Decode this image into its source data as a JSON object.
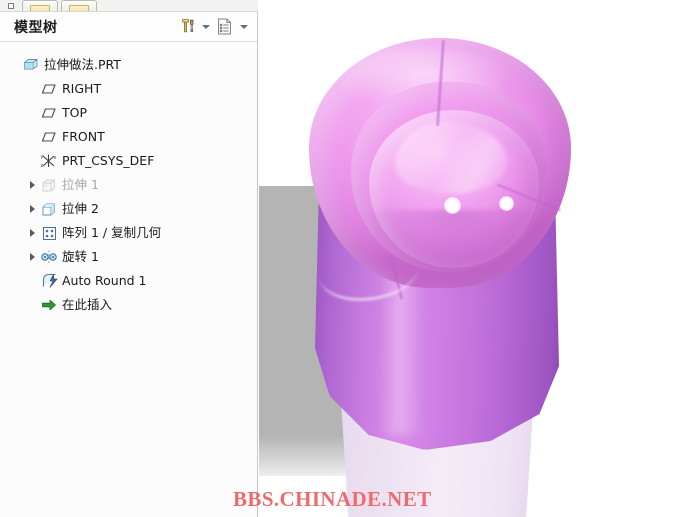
{
  "window": {
    "tabstrip": {
      "pin_icon": "pin-icon",
      "tabs": [
        {
          "name": "folder-tab-1",
          "icon": "folder-icon"
        },
        {
          "name": "folder-tab-2",
          "icon": "folder-icon"
        }
      ]
    }
  },
  "tree_panel": {
    "title": "模型树",
    "toolbar": [
      {
        "name": "settings-tools-button",
        "icon": "hammer-screwdriver-icon"
      },
      {
        "name": "settings-tools-dropdown",
        "icon": "chevron-down-icon"
      },
      {
        "name": "display-list-button",
        "icon": "document-list-icon"
      },
      {
        "name": "display-list-dropdown",
        "icon": "chevron-down-icon"
      }
    ],
    "items": [
      {
        "label": "拉伸做法.PRT",
        "icon": "part-icon",
        "level": 0,
        "expander": false,
        "dim": false
      },
      {
        "label": "RIGHT",
        "icon": "datum-plane-icon",
        "level": 1,
        "expander": false,
        "dim": false
      },
      {
        "label": "TOP",
        "icon": "datum-plane-icon",
        "level": 1,
        "expander": false,
        "dim": false
      },
      {
        "label": "FRONT",
        "icon": "datum-plane-icon",
        "level": 1,
        "expander": false,
        "dim": false
      },
      {
        "label": "PRT_CSYS_DEF",
        "icon": "coordinate-system-icon",
        "level": 1,
        "expander": false,
        "dim": false
      },
      {
        "label": "拉伸 1",
        "icon": "extrude-icon",
        "level": 1,
        "expander": true,
        "dim": true
      },
      {
        "label": "拉伸 2",
        "icon": "extrude-icon",
        "level": 1,
        "expander": true,
        "dim": false
      },
      {
        "label": "阵列 1 / 复制几何",
        "icon": "pattern-icon",
        "level": 1,
        "expander": true,
        "dim": false
      },
      {
        "label": "旋转 1",
        "icon": "revolve-icon",
        "level": 1,
        "expander": true,
        "dim": false
      },
      {
        "label": "Auto Round 1",
        "icon": "auto-round-icon",
        "level": 1,
        "expander": false,
        "dim": false
      },
      {
        "label": "在此插入",
        "icon": "insert-here-arrow-icon",
        "level": 1,
        "expander": false,
        "dim": false
      }
    ]
  },
  "viewport": {
    "name": "3d-model-viewport",
    "background_color": "#ffffff",
    "model": {
      "name": "pink-swirl-cap-part",
      "body_color": "#c373dd",
      "rim_color": "#f3a6f1",
      "dome_color": "#f6b3f4",
      "shadow_color": "#b4b4b4"
    }
  },
  "watermark": {
    "text": "BBS.CHINADE.NET",
    "color": "#ef6a6f"
  }
}
